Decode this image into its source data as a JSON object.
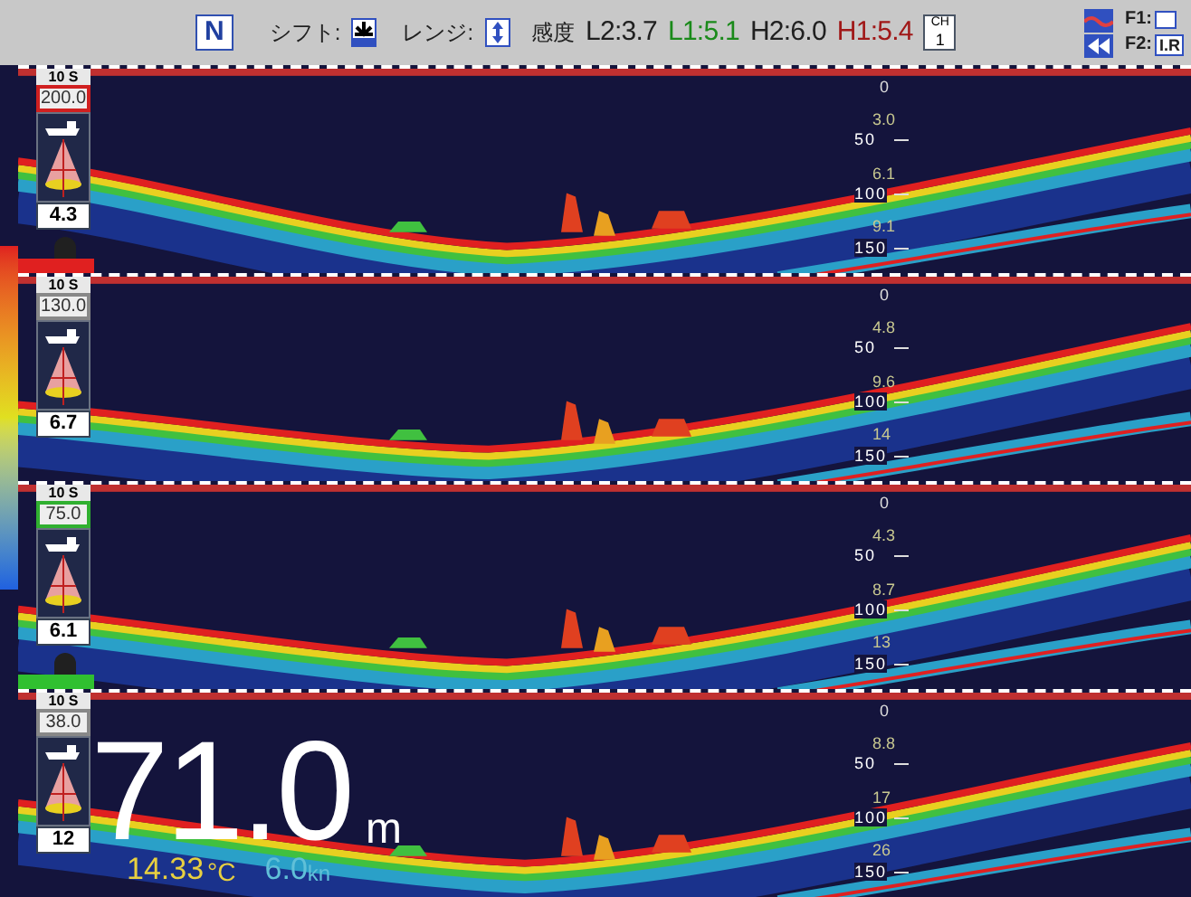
{
  "header": {
    "heading_mode": "N",
    "shift_label": "シフト:",
    "range_label": "レンジ:",
    "gain_label": "感度",
    "gains": [
      {
        "text": "L2:3.7",
        "color": "#202020"
      },
      {
        "text": "L1:5.1",
        "color": "#1a8a1a"
      },
      {
        "text": "H2:6.0",
        "color": "#202020"
      },
      {
        "text": "H1:5.4",
        "color": "#a01818"
      }
    ],
    "channel_label": "CH",
    "channel": "1",
    "f1_label": "F1:",
    "f2_label": "F2:",
    "f2_value": "I.R"
  },
  "panels": [
    {
      "interval": "10 S",
      "range": "200.0",
      "range_frame": {
        "color": "#d02020"
      },
      "depth": "4.3",
      "zero": "0",
      "marker": {
        "color": "#e02020"
      },
      "scale": [
        {
          "reading": "3.0",
          "depth": "50"
        },
        {
          "reading": "6.1",
          "depth": "100"
        },
        {
          "reading": "9.1",
          "depth": "150"
        }
      ]
    },
    {
      "interval": "10 S",
      "range": "130.0",
      "depth": "6.7",
      "zero": "0",
      "scale": [
        {
          "reading": "4.8",
          "depth": "50"
        },
        {
          "reading": "9.6",
          "depth": "100"
        },
        {
          "reading": "14",
          "depth": "150"
        }
      ]
    },
    {
      "interval": "10 S",
      "range": "75.0",
      "range_frame": {
        "color": "#30b030"
      },
      "depth": "6.1",
      "zero": "0",
      "marker": {
        "color": "#30c030"
      },
      "scale": [
        {
          "reading": "4.3",
          "depth": "50"
        },
        {
          "reading": "8.7",
          "depth": "100"
        },
        {
          "reading": "13",
          "depth": "150"
        }
      ]
    },
    {
      "interval": "10 S",
      "range": "38.0",
      "depth": "12",
      "zero": "0",
      "scale": [
        {
          "reading": "8.8",
          "depth": "50"
        },
        {
          "reading": "17",
          "depth": "100"
        },
        {
          "reading": "26",
          "depth": "150"
        }
      ]
    }
  ],
  "readout": {
    "depth": "71.0",
    "depth_unit": "m",
    "temperature": "14.33",
    "temperature_unit": "°C",
    "speed": "6.0",
    "speed_unit": "kn"
  }
}
